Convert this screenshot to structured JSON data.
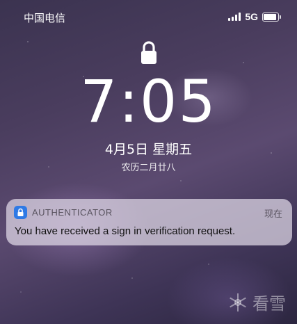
{
  "status_bar": {
    "carrier": "中国电信",
    "network": "5G",
    "signal_bars": 4,
    "battery_level": 0.8
  },
  "lock_screen": {
    "time": "7:05",
    "date": "4月5日 星期五",
    "lunar_date": "农历二月廿八"
  },
  "notification": {
    "app_name": "AUTHENTICATOR",
    "time": "现在",
    "message": "You have received a sign in verification request."
  },
  "watermark": {
    "text": "看雪"
  },
  "icons": {
    "lock": "lock-icon",
    "app": "authenticator-icon",
    "watermark": "snowflake-icon"
  },
  "colors": {
    "accent": "#2f7ae5",
    "notification_bg": "#e1dae8"
  }
}
